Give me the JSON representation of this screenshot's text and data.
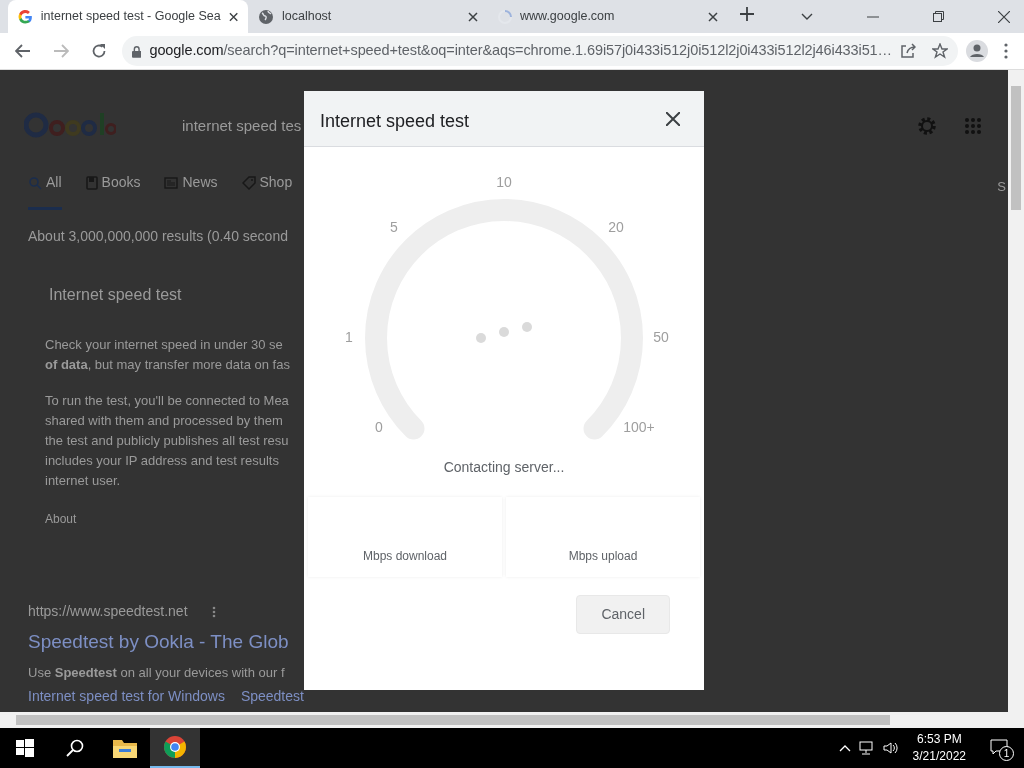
{
  "browser": {
    "tabs": [
      {
        "title": "internet speed test - Google Sea",
        "selected": true,
        "kind": "google"
      },
      {
        "title": "localhost",
        "selected": false,
        "kind": "globe"
      },
      {
        "title": "www.google.com",
        "selected": false,
        "kind": "loading"
      }
    ],
    "address": {
      "host": "google.com",
      "path": "/search?q=internet+speed+test&oq=inter&aqs=chrome.1.69i57j0i433i512j0i512l2j0i433i512l2j46i433i51…"
    }
  },
  "page": {
    "search_query": "internet speed tes",
    "tabs": [
      {
        "label": "All",
        "selected": true,
        "kind": "search"
      },
      {
        "label": "Books",
        "selected": false,
        "kind": "book"
      },
      {
        "label": "News",
        "selected": false,
        "kind": "news"
      },
      {
        "label": "Shop",
        "selected": false,
        "kind": "tag"
      }
    ],
    "tools_tab": "S",
    "result_count": "About 3,000,000,000 results (0.40 second",
    "card": {
      "title": "Internet speed test",
      "paragraphs": [
        [
          "Check your internet speed in under 30 se",
          "**of data**, but may transfer more data on fas"
        ],
        [
          "To run the test, you'll be connected to Mea",
          "shared with them and processed by them",
          "the test and publicly publishes all test resu",
          "includes your IP address and test results",
          "internet user."
        ]
      ],
      "about": "About"
    },
    "result": {
      "url": "https://www.speedtest.net",
      "title": "Speedtest by Ookla - The Glob",
      "snippet": "Use **Speedtest** on all your devices with our f",
      "links": [
        "Internet speed test for Windows",
        "Speedtest"
      ]
    }
  },
  "dialog": {
    "title": "Internet speed test",
    "scale": [
      "0",
      "1",
      "5",
      "10",
      "20",
      "50",
      "100+"
    ],
    "status": "Contacting server...",
    "download_label": "Mbps download",
    "upload_label": "Mbps upload",
    "cancel": "Cancel"
  },
  "taskbar": {
    "time": "6:53 PM",
    "date": "3/21/2022",
    "notifications": "1"
  }
}
